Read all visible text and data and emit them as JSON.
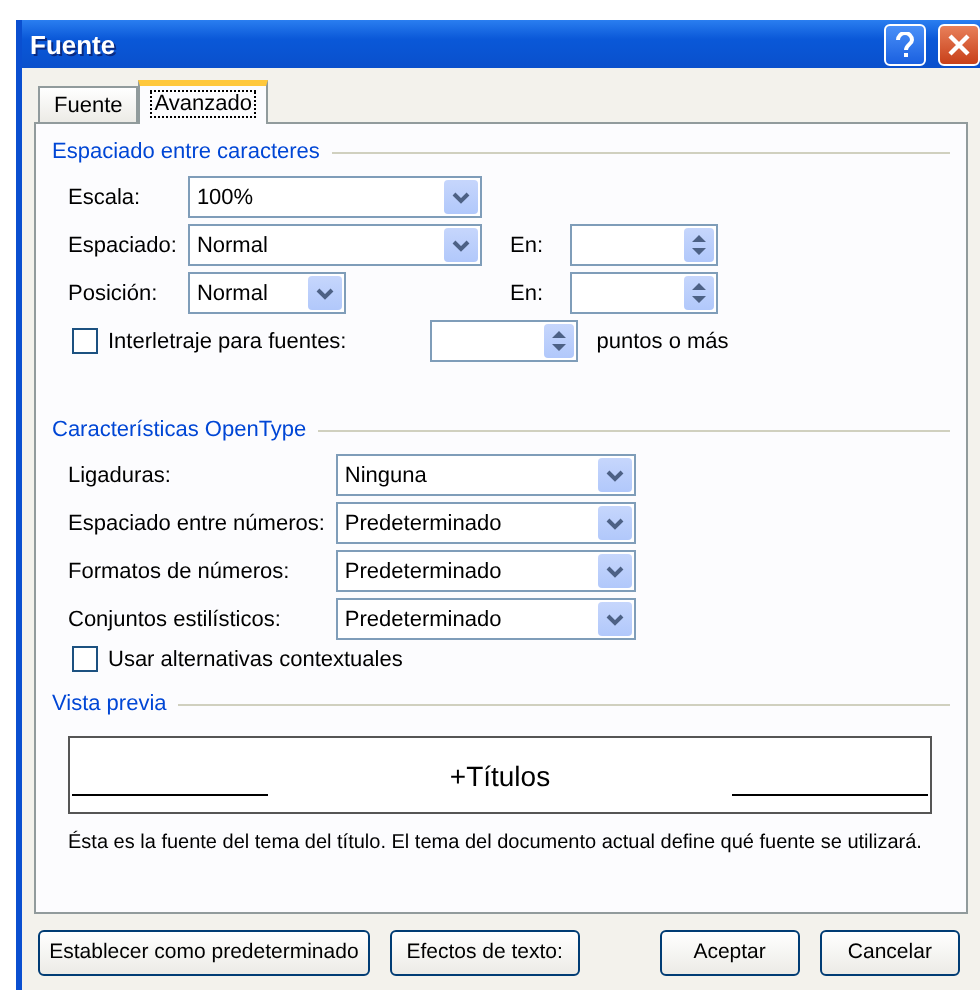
{
  "window": {
    "title": "Fuente"
  },
  "tabs": [
    {
      "label": "Fuente",
      "selected": false
    },
    {
      "label": "Avanzado",
      "selected": true
    }
  ],
  "sections": [
    {
      "title": "Espaciado entre caracteres",
      "rows": [
        {
          "kind": "combo",
          "label": "Escala:",
          "value": "100%"
        },
        {
          "kind": "combo",
          "label": "Espaciado:",
          "value": "Normal",
          "spin_label": "En:"
        },
        {
          "kind": "short-combo",
          "label": "Posición:",
          "value": "Normal",
          "spin_label": "En:"
        },
        {
          "kind": "check-spin",
          "label": "Interletraje para fuentes:",
          "checked": false,
          "suffix": "puntos o más"
        }
      ]
    },
    {
      "title": "Características OpenType",
      "rows": [
        {
          "kind": "combo",
          "label": "Ligaduras:",
          "value": "Ninguna"
        },
        {
          "kind": "combo",
          "label": "Espaciado entre números:",
          "value": "Predeterminado"
        },
        {
          "kind": "combo",
          "label": "Formatos de números:",
          "value": "Predeterminado"
        },
        {
          "kind": "combo",
          "label": "Conjuntos estilísticos:",
          "value": "Predeterminado"
        },
        {
          "kind": "check",
          "label": "Usar alternativas contextuales",
          "checked": false
        }
      ]
    }
  ],
  "preview": {
    "title": "Vista previa",
    "sample": "+Títulos",
    "description": "Ésta es la fuente del tema del título. El tema del documento actual define qué fuente se utilizará."
  },
  "buttons": [
    "Establecer como predeterminado",
    "Efectos de texto:",
    "Aceptar",
    "Cancelar"
  ]
}
